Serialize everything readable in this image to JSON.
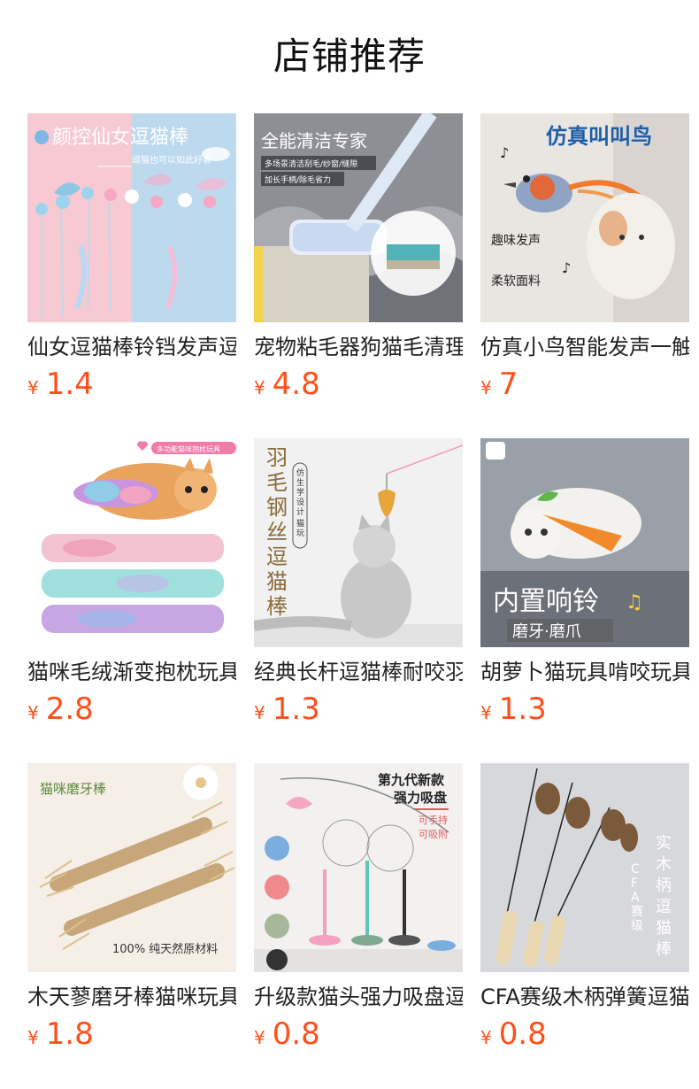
{
  "page": {
    "title": "店铺推荐"
  },
  "products": [
    {
      "name": "仙女逗猫棒铃铛发声逗猫玩具",
      "currency": "¥",
      "price": "1.4",
      "image": {
        "icon": "feather-wand-image",
        "headline": "颜控仙女逗猫棒",
        "sub": "逗猫也可以如此好看"
      }
    },
    {
      "name": "宠物粘毛器狗猫毛清理刷",
      "currency": "¥",
      "price": "4.8",
      "image": {
        "icon": "lint-roller-image",
        "headline": "全能清洁专家",
        "sub": "多场景清洁刮毛/纱窗/缝隙",
        "sub2": "加长手柄/除毛省力"
      }
    },
    {
      "name": "仿真小鸟智能发声一触即叫",
      "currency": "¥",
      "price": "7",
      "image": {
        "icon": "bird-toy-image",
        "headline": "仿真叫叫鸟",
        "sub": "趣味发声",
        "sub2": "柔软面料"
      }
    },
    {
      "name": "猫咪毛绒渐变抱枕玩具",
      "currency": "¥",
      "price": "2.8",
      "image": {
        "icon": "plush-pillow-image",
        "headline": "多功能猫咪抱枕玩具"
      }
    },
    {
      "name": "经典长杆逗猫棒耐咬羽毛",
      "currency": "¥",
      "price": "1.3",
      "image": {
        "icon": "cat-wand-image",
        "headline": "羽毛钢丝逗猫棒",
        "sub": "仿生学设计 猫玩不停"
      }
    },
    {
      "name": "胡萝卜猫玩具啃咬玩具",
      "currency": "¥",
      "price": "1.3",
      "image": {
        "icon": "carrot-toy-image",
        "headline": "内置响铃",
        "sub": "磨牙·磨爪"
      }
    },
    {
      "name": "木天蓼磨牙棒猫咪玩具",
      "currency": "¥",
      "price": "1.8",
      "image": {
        "icon": "chew-stick-image",
        "headline": "猫咪磨牙棒",
        "sub": "100% 纯天然原材料"
      }
    },
    {
      "name": "升级款猫头强力吸盘逗猫棒",
      "currency": "¥",
      "price": "0.8",
      "image": {
        "icon": "suction-wand-image",
        "headline": "第九代新款",
        "sub": "强力吸盘",
        "sub2": "可手持",
        "sub3": "可吸附"
      }
    },
    {
      "name": "CFA赛级木柄弹簧逗猫棒",
      "currency": "¥",
      "price": "0.8",
      "image": {
        "icon": "wooden-wand-image",
        "headline": "实木柄逗猫棒",
        "sub": "CFA赛级"
      }
    }
  ],
  "colors": {
    "price": "#ff4f1a",
    "title": "#111111"
  }
}
